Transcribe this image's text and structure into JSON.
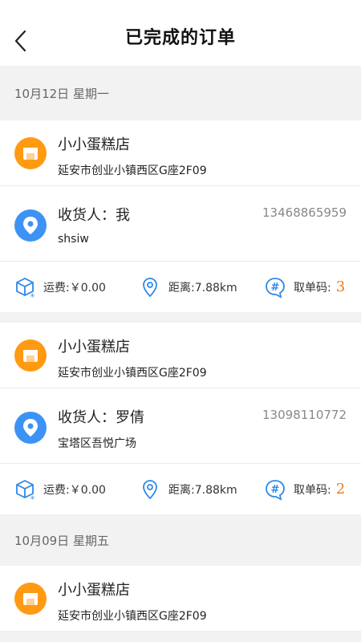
{
  "header": {
    "title": "已完成的订单"
  },
  "groups": [
    {
      "date": "10月12日  星期一",
      "orders": [
        {
          "shop_name": "小小蛋糕店",
          "shop_address": "延安市创业小镇西区G座2F09",
          "receiver": "收货人：我",
          "receiver_address": "shsiw",
          "phone": "13468865959",
          "fee": "运费:￥0.00",
          "distance": "距离:7.88km",
          "pickup_label": "取单码:",
          "pickup_code": "3"
        },
        {
          "shop_name": "小小蛋糕店",
          "shop_address": "延安市创业小镇西区G座2F09",
          "receiver": "收货人：罗倩",
          "receiver_address": "宝塔区吾悦广场",
          "phone": "13098110772",
          "fee": "运费:￥0.00",
          "distance": "距离:7.88km",
          "pickup_label": "取单码:",
          "pickup_code": "2"
        }
      ]
    },
    {
      "date": "10月09日  星期五",
      "orders": [
        {
          "shop_name": "小小蛋糕店",
          "shop_address": "延安市创业小镇西区G座2F09"
        }
      ]
    }
  ],
  "icons": {
    "back": "chevron-left-icon",
    "shop": "shop-icon",
    "location": "location-pin-icon",
    "fee": "box-icon",
    "distance": "map-pin-icon",
    "pickup": "hash-icon"
  },
  "colors": {
    "shop_icon": "#ff9a12",
    "location_icon": "#3c93f5",
    "pickup_code": "#ee7a10"
  }
}
